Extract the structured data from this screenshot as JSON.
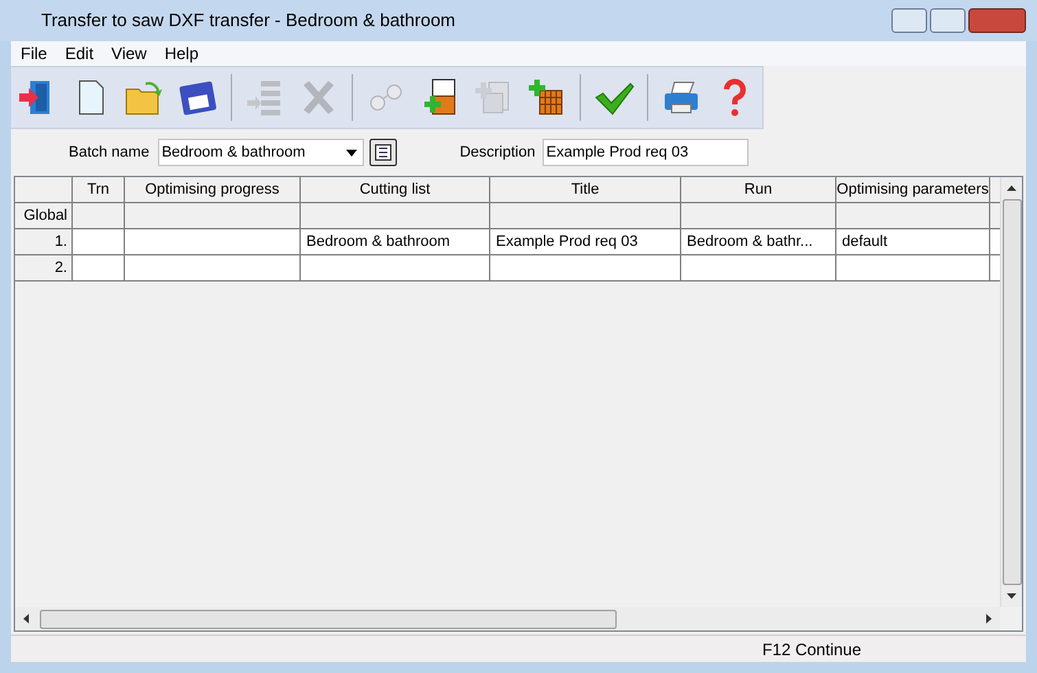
{
  "window": {
    "title": "Transfer to saw DXF transfer - Bedroom & bathroom"
  },
  "menu": [
    "File",
    "Edit",
    "View",
    "Help"
  ],
  "toolbar": [
    {
      "kind": "exit",
      "disabled": false
    },
    {
      "kind": "new",
      "disabled": false
    },
    {
      "kind": "open",
      "disabled": false
    },
    {
      "kind": "save",
      "disabled": false
    },
    {
      "kind": "sep"
    },
    {
      "kind": "insert",
      "disabled": true
    },
    {
      "kind": "delete",
      "disabled": true
    },
    {
      "kind": "sep"
    },
    {
      "kind": "glasses",
      "disabled": true
    },
    {
      "kind": "addlist",
      "disabled": false
    },
    {
      "kind": "copy",
      "disabled": true
    },
    {
      "kind": "addgrid",
      "disabled": false
    },
    {
      "kind": "sep"
    },
    {
      "kind": "check",
      "disabled": false
    },
    {
      "kind": "sep"
    },
    {
      "kind": "print",
      "disabled": false
    },
    {
      "kind": "help",
      "disabled": false
    }
  ],
  "batch": {
    "label": "Batch name",
    "value": "Bedroom & bathroom",
    "description_label": "Description",
    "description": "Example Prod req 03"
  },
  "table": {
    "columns": [
      "Trn",
      "Optimising progress",
      "Cutting list",
      "Title",
      "Run",
      "Optimising parameters"
    ],
    "rows": [
      {
        "header": "Global",
        "cells": [
          "",
          "",
          "",
          "",
          "",
          ""
        ]
      },
      {
        "header": "1.",
        "cells": [
          "",
          "",
          "Bedroom & bathroom",
          "Example Prod req 03",
          "Bedroom & bathr...",
          "default"
        ]
      },
      {
        "header": "2.",
        "cells": [
          "",
          "",
          "",
          "",
          "",
          ""
        ]
      }
    ]
  },
  "status_bar": {
    "text": "F12 Continue"
  }
}
